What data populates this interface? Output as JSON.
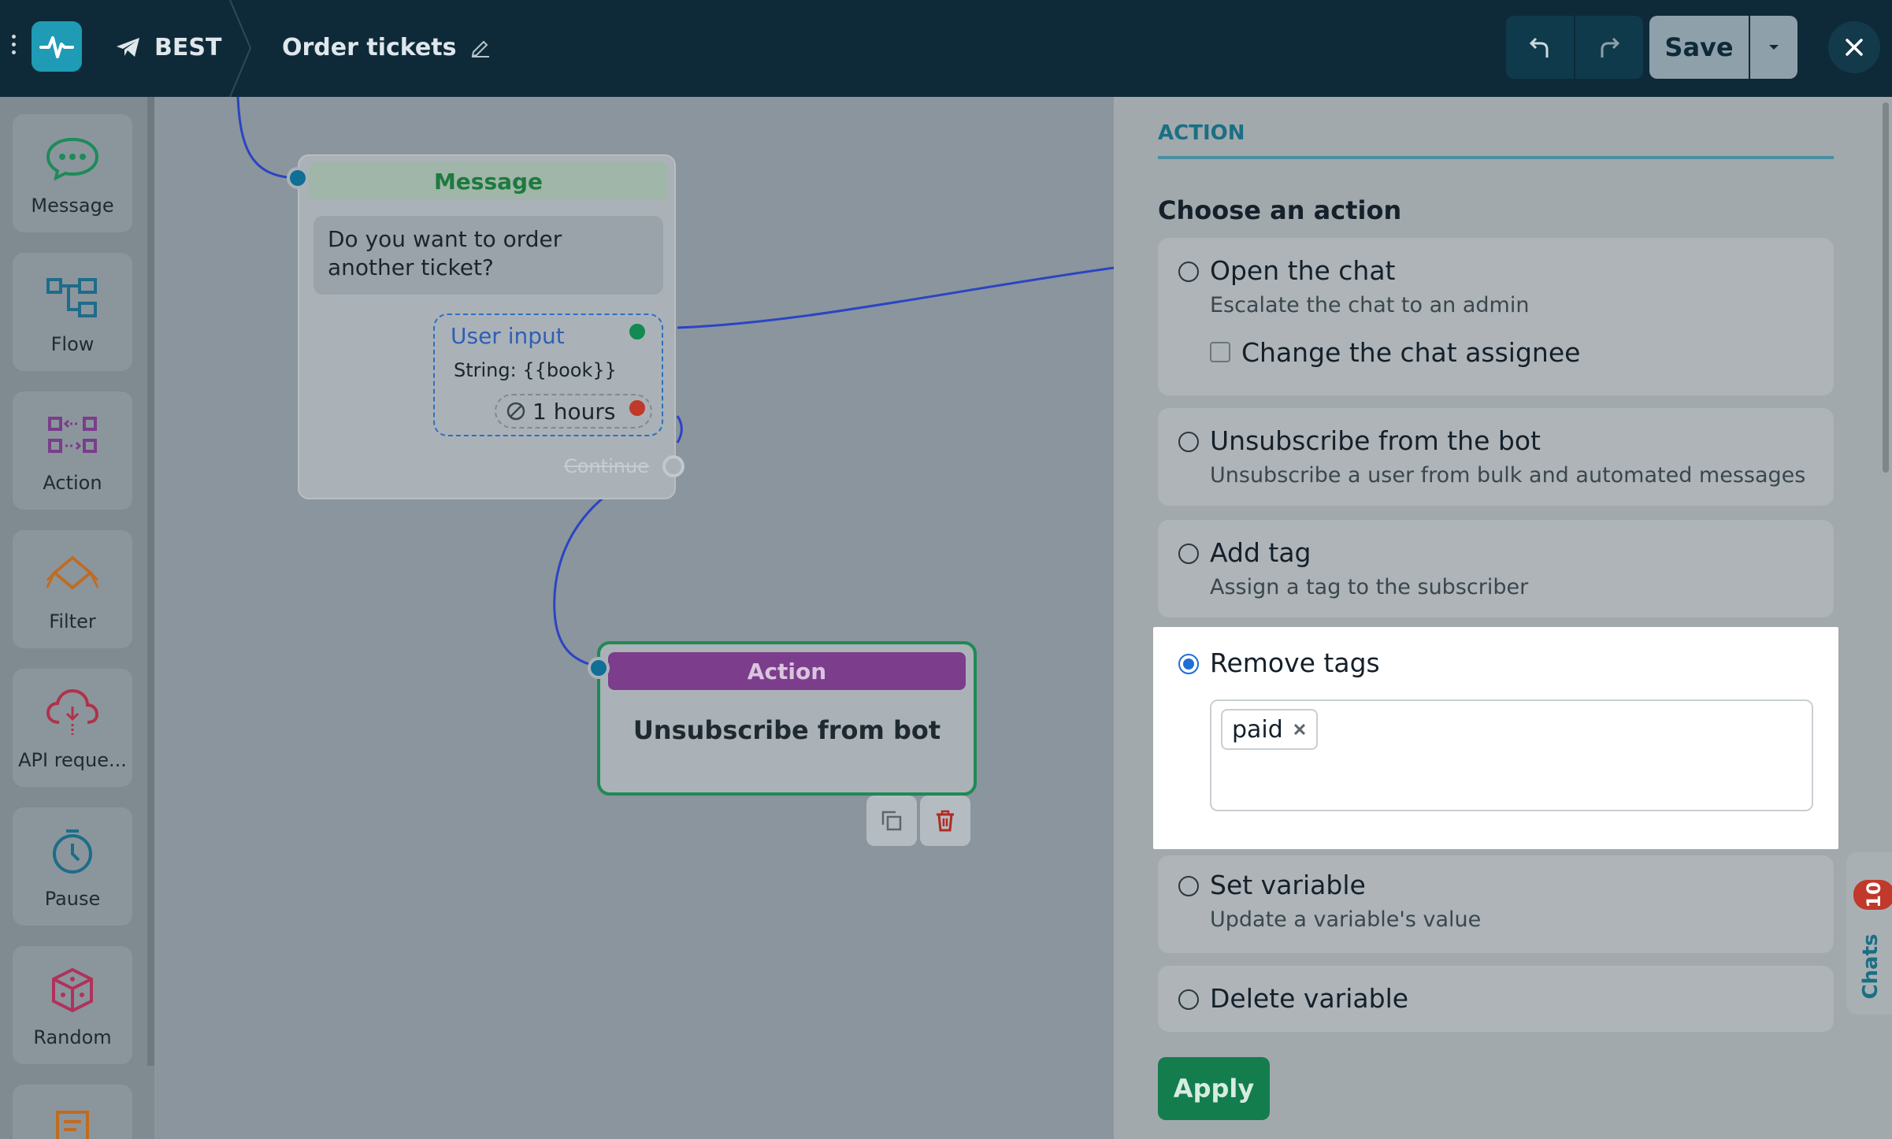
{
  "header": {
    "bot_name": "BEST",
    "flow_title": "Order tickets",
    "save_label": "Save"
  },
  "palette": {
    "items": [
      {
        "label": "Message",
        "icon": "message-bubble-icon",
        "color": "#1e8a5a"
      },
      {
        "label": "Flow",
        "icon": "flow-icon",
        "color": "#1e6c8a"
      },
      {
        "label": "Action",
        "icon": "action-icon",
        "color": "#7a3d8c"
      },
      {
        "label": "Filter",
        "icon": "filter-icon",
        "color": "#c06b22"
      },
      {
        "label": "API reque...",
        "icon": "api-cloud-icon",
        "color": "#b0324a"
      },
      {
        "label": "Pause",
        "icon": "clock-icon",
        "color": "#1e6c8a"
      },
      {
        "label": "Random",
        "icon": "dice-icon",
        "color": "#b0325a"
      }
    ]
  },
  "canvas": {
    "message_node": {
      "header": "Message",
      "text": "Do you want to order another ticket?",
      "user_input_title": "User input",
      "user_input_type": "String: {{book}}",
      "timeout": "1 hours",
      "continue_label": "Continue"
    },
    "action_node": {
      "header": "Action",
      "body": "Unsubscribe from bot"
    }
  },
  "panel": {
    "tab": "ACTION",
    "section_title": "Choose an action",
    "options": [
      {
        "title": "Open the chat",
        "desc": "Escalate the chat to an admin",
        "checkbox": "Change the chat assignee"
      },
      {
        "title": "Unsubscribe from the bot",
        "desc": "Unsubscribe a user from bulk and automated messages"
      },
      {
        "title": "Add tag",
        "desc": "Assign a tag to the subscriber"
      },
      {
        "title": "Remove tags",
        "tag": "paid"
      },
      {
        "title": "Set variable",
        "desc": "Update a variable's value"
      },
      {
        "title": "Delete variable"
      }
    ],
    "apply_label": "Apply"
  },
  "chats_tab": {
    "label": "Chats",
    "count": "10"
  },
  "colors": {
    "header_bg": "#0e2a38",
    "accent_teal": "#1f9bb5",
    "apply_green": "#137d4d",
    "selected_radio": "#1e6fd6",
    "action_purple": "#7c3d8c"
  }
}
